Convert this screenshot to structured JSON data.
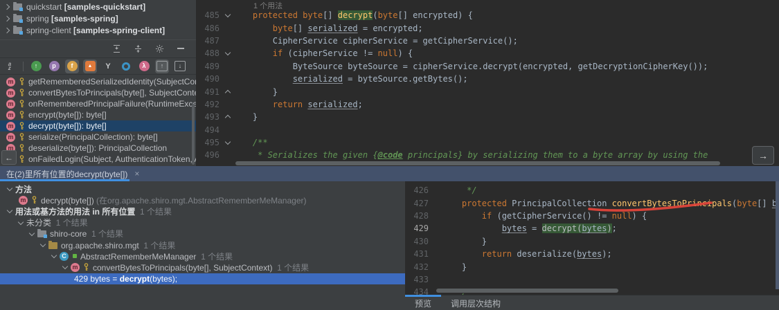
{
  "colors": {
    "editor_bg": "#2b2b2b",
    "panel_bg": "#3c3f41",
    "keyword": "#cc7832",
    "method_decl": "#ffc66d",
    "comment": "#629755",
    "search_highlight_bg": "#365936",
    "selection_blue": "#3d6bbf",
    "structure_selection": "#1e4266",
    "header_band": "#43516b",
    "tab_underline": "#4090e0",
    "annotation_red": "#e0443a"
  },
  "project_panel": {
    "items": [
      {
        "name": "quickstart",
        "tag": "[samples-quickstart]"
      },
      {
        "name": "spring",
        "tag": "[samples-spring]"
      },
      {
        "name": "spring-client",
        "tag": "[samples-spring-client]"
      }
    ],
    "toolbar": [
      {
        "name": "expand-all-icon",
        "kind": "expand"
      },
      {
        "name": "collapse-all-icon",
        "kind": "collapse"
      },
      {
        "name": "settings-gear-icon",
        "kind": "gear"
      },
      {
        "name": "hide-panel-icon",
        "kind": "minus"
      }
    ]
  },
  "structure_panel": {
    "toolbar": [
      {
        "name": "sort-alphabetically-icon",
        "kind": "az"
      },
      {
        "name": "show-inherited-icon",
        "kind": "circle",
        "letter": "↑",
        "bg": "#4a9b50"
      },
      {
        "name": "show-properties-icon",
        "kind": "circle",
        "letter": "p",
        "bg": "#9678b0"
      },
      {
        "name": "show-fields-icon",
        "kind": "circle",
        "letter": "f",
        "bg": "#d9a34a",
        "active": true
      },
      {
        "name": "show-anonymous-classes-icon",
        "kind": "square",
        "letter": "▲",
        "bg": "#e07a3c",
        "active": true
      },
      {
        "name": "group-methods-icon",
        "kind": "plain",
        "letter": "Y"
      },
      {
        "name": "show-visibility-icon",
        "kind": "donut"
      },
      {
        "name": "show-lambdas-icon",
        "kind": "circle",
        "letter": "λ",
        "bg": "#cf6a8a"
      },
      {
        "name": "autoscroll-to-source-icon",
        "kind": "arrowbox",
        "letter": "↑",
        "active": true
      },
      {
        "name": "autoscroll-from-source-icon",
        "kind": "arrowbox",
        "letter": "↓"
      }
    ],
    "methods": [
      {
        "label": "getRememberedSerializedIdentity(SubjectContext):"
      },
      {
        "label": "convertBytesToPrincipals(byte[], SubjectContext): Pr"
      },
      {
        "label": "onRememberedPrincipalFailure(RuntimeException, "
      },
      {
        "label": "encrypt(byte[]): byte[]"
      },
      {
        "label": "decrypt(byte[]): byte[]",
        "selected": true
      },
      {
        "label": "serialize(PrincipalCollection): byte[]"
      },
      {
        "label": "deserialize(byte[]): PrincipalCollection"
      },
      {
        "label": "onFailedLogin(Subject, AuthenticationToken, Authe"
      }
    ]
  },
  "editor_top": {
    "lines": [
      {
        "hint": "1 个用法"
      },
      {
        "n": "485",
        "f": "d",
        "s": [
          {
            "t": "    protected ",
            "c": "kw"
          },
          {
            "t": "byte",
            "c": "kw"
          },
          {
            "t": "[] ",
            "c": "pl"
          },
          {
            "t": "decrypt",
            "c": "decl hl"
          },
          {
            "t": "(",
            "c": "pl"
          },
          {
            "t": "byte",
            "c": "kw"
          },
          {
            "t": "[] encrypted) {",
            "c": "pl"
          }
        ]
      },
      {
        "n": "486",
        "s": [
          {
            "t": "        byte",
            "c": "kw"
          },
          {
            "t": "[] ",
            "c": "pl"
          },
          {
            "t": "serialized",
            "c": "var"
          },
          {
            "t": " = encrypted;",
            "c": "pl"
          }
        ]
      },
      {
        "n": "487",
        "s": [
          {
            "t": "        CipherService cipherService = getCipherService();",
            "c": "pl"
          }
        ]
      },
      {
        "n": "488",
        "f": "d",
        "s": [
          {
            "t": "        if",
            "c": "kw"
          },
          {
            "t": " (cipherService != ",
            "c": "pl"
          },
          {
            "t": "null",
            "c": "kw"
          },
          {
            "t": ") {",
            "c": "pl"
          }
        ]
      },
      {
        "n": "489",
        "s": [
          {
            "t": "            ByteSource byteSource = cipherService.decrypt(encrypted, getDecryptionCipherKey());",
            "c": "pl"
          }
        ]
      },
      {
        "n": "490",
        "s": [
          {
            "t": "            ",
            "c": "pl"
          },
          {
            "t": "serialized",
            "c": "var"
          },
          {
            "t": " = byteSource.getBytes();",
            "c": "pl"
          }
        ]
      },
      {
        "n": "491",
        "f": "u",
        "s": [
          {
            "t": "        }",
            "c": "pl"
          }
        ]
      },
      {
        "n": "492",
        "s": [
          {
            "t": "        return ",
            "c": "kw"
          },
          {
            "t": "serialized",
            "c": "var"
          },
          {
            "t": ";",
            "c": "pl"
          }
        ]
      },
      {
        "n": "493",
        "f": "u",
        "s": [
          {
            "t": "    }",
            "c": "pl"
          }
        ]
      },
      {
        "n": "494",
        "s": []
      },
      {
        "n": "495",
        "f": "d",
        "s": [
          {
            "t": "    /**",
            "c": "cm"
          }
        ]
      },
      {
        "n": "496",
        "s": [
          {
            "t": "     * Serializes the given {",
            "c": "cm"
          },
          {
            "t": "@code",
            "c": "doc"
          },
          {
            "t": " principals} by serializing them to a byte array by using the",
            "c": "cm"
          }
        ]
      }
    ]
  },
  "usages_panel": {
    "tab_title": "在(2)里所有位置的decrypt(byte[])",
    "close_glyph": "×",
    "tree": [
      {
        "ind": 0,
        "chev": true,
        "s": [
          {
            "t": "方法",
            "c": "b"
          }
        ]
      },
      {
        "ind": 1,
        "icons": [
          "method",
          "key"
        ],
        "s": [
          {
            "t": "decrypt(byte[]) ",
            "c": "t"
          },
          {
            "t": "(在org.apache.shiro.mgt.AbstractRememberMeManager)",
            "c": "dim"
          }
        ]
      },
      {
        "ind": 0,
        "chev": true,
        "s": [
          {
            "t": "用法或基方法的用法 in 所有位置",
            "c": "b"
          },
          {
            "t": "  1 个结果",
            "c": "dim"
          }
        ]
      },
      {
        "ind": 1,
        "chev": true,
        "s": [
          {
            "t": "未分类",
            "c": "t"
          },
          {
            "t": "  1 个结果",
            "c": "dim"
          }
        ]
      },
      {
        "ind": 2,
        "chev": true,
        "icons": [
          "module"
        ],
        "s": [
          {
            "t": "shiro-core",
            "c": "t"
          },
          {
            "t": "  1 个结果",
            "c": "dim"
          }
        ]
      },
      {
        "ind": 3,
        "chev": true,
        "icons": [
          "package"
        ],
        "s": [
          {
            "t": "org.apache.shiro.mgt",
            "c": "t"
          },
          {
            "t": "  1 个结果",
            "c": "dim"
          }
        ]
      },
      {
        "ind": 4,
        "chev": true,
        "icons": [
          "class"
        ],
        "s": [
          {
            "t": "AbstractRememberMeManager",
            "c": "t"
          },
          {
            "t": "  1 个结果",
            "c": "dim"
          }
        ]
      },
      {
        "ind": 5,
        "chev": true,
        "icons": [
          "method",
          "key"
        ],
        "s": [
          {
            "t": "convertBytesToPrincipals(byte[], SubjectContext)",
            "c": "t"
          },
          {
            "t": "  1 个结果",
            "c": "dim"
          }
        ]
      },
      {
        "ind": 6,
        "sel": true,
        "s": [
          {
            "t": "429 ",
            "c": "num"
          },
          {
            "t": "bytes = ",
            "c": "t"
          },
          {
            "t": "decrypt",
            "c": "b"
          },
          {
            "t": "(bytes);",
            "c": "t"
          }
        ]
      }
    ]
  },
  "editor_preview": {
    "lines": [
      {
        "n": "426",
        "s": [
          {
            "t": "     */",
            "c": "cm"
          }
        ]
      },
      {
        "n": "427",
        "s": [
          {
            "t": "    protected",
            "c": "kw"
          },
          {
            "t": " PrincipalCollection ",
            "c": "pl"
          },
          {
            "t": "convertBytesToPrincipals",
            "c": "decl"
          },
          {
            "t": "(",
            "c": "pl"
          },
          {
            "t": "byte",
            "c": "kw"
          },
          {
            "t": "[] ",
            "c": "pl"
          },
          {
            "t": "bytes",
            "c": "var"
          },
          {
            "t": ", Su",
            "c": "pl"
          }
        ]
      },
      {
        "n": "428",
        "s": [
          {
            "t": "        if",
            "c": "kw"
          },
          {
            "t": " (getCipherService() != ",
            "c": "pl"
          },
          {
            "t": "null",
            "c": "kw"
          },
          {
            "t": ") {",
            "c": "pl"
          }
        ]
      },
      {
        "n": "429",
        "a": true,
        "s": [
          {
            "t": "            ",
            "c": "pl"
          },
          {
            "t": "bytes",
            "c": "var"
          },
          {
            "t": " = ",
            "c": "pl"
          },
          {
            "t": "decrypt(",
            "c": "hl"
          },
          {
            "t": "bytes",
            "c": "var hl"
          },
          {
            "t": ")",
            "c": "hl"
          },
          {
            "t": ";",
            "c": "pl"
          }
        ]
      },
      {
        "n": "430",
        "s": [
          {
            "t": "        }",
            "c": "pl"
          }
        ]
      },
      {
        "n": "431",
        "s": [
          {
            "t": "        return",
            "c": "kw"
          },
          {
            "t": " deserialize(",
            "c": "pl"
          },
          {
            "t": "bytes",
            "c": "var"
          },
          {
            "t": ");",
            "c": "pl"
          }
        ]
      },
      {
        "n": "432",
        "s": [
          {
            "t": "    }",
            "c": "pl"
          }
        ]
      },
      {
        "n": "433",
        "s": []
      },
      {
        "n": "434",
        "s": [
          {
            "t": "    /**",
            "c": "cm"
          }
        ]
      }
    ],
    "tabs": [
      {
        "label": "预览",
        "selected": true
      },
      {
        "label": "调用层次结构"
      }
    ]
  },
  "floating": {
    "back_glyph": "←",
    "forward_glyph": "→"
  }
}
